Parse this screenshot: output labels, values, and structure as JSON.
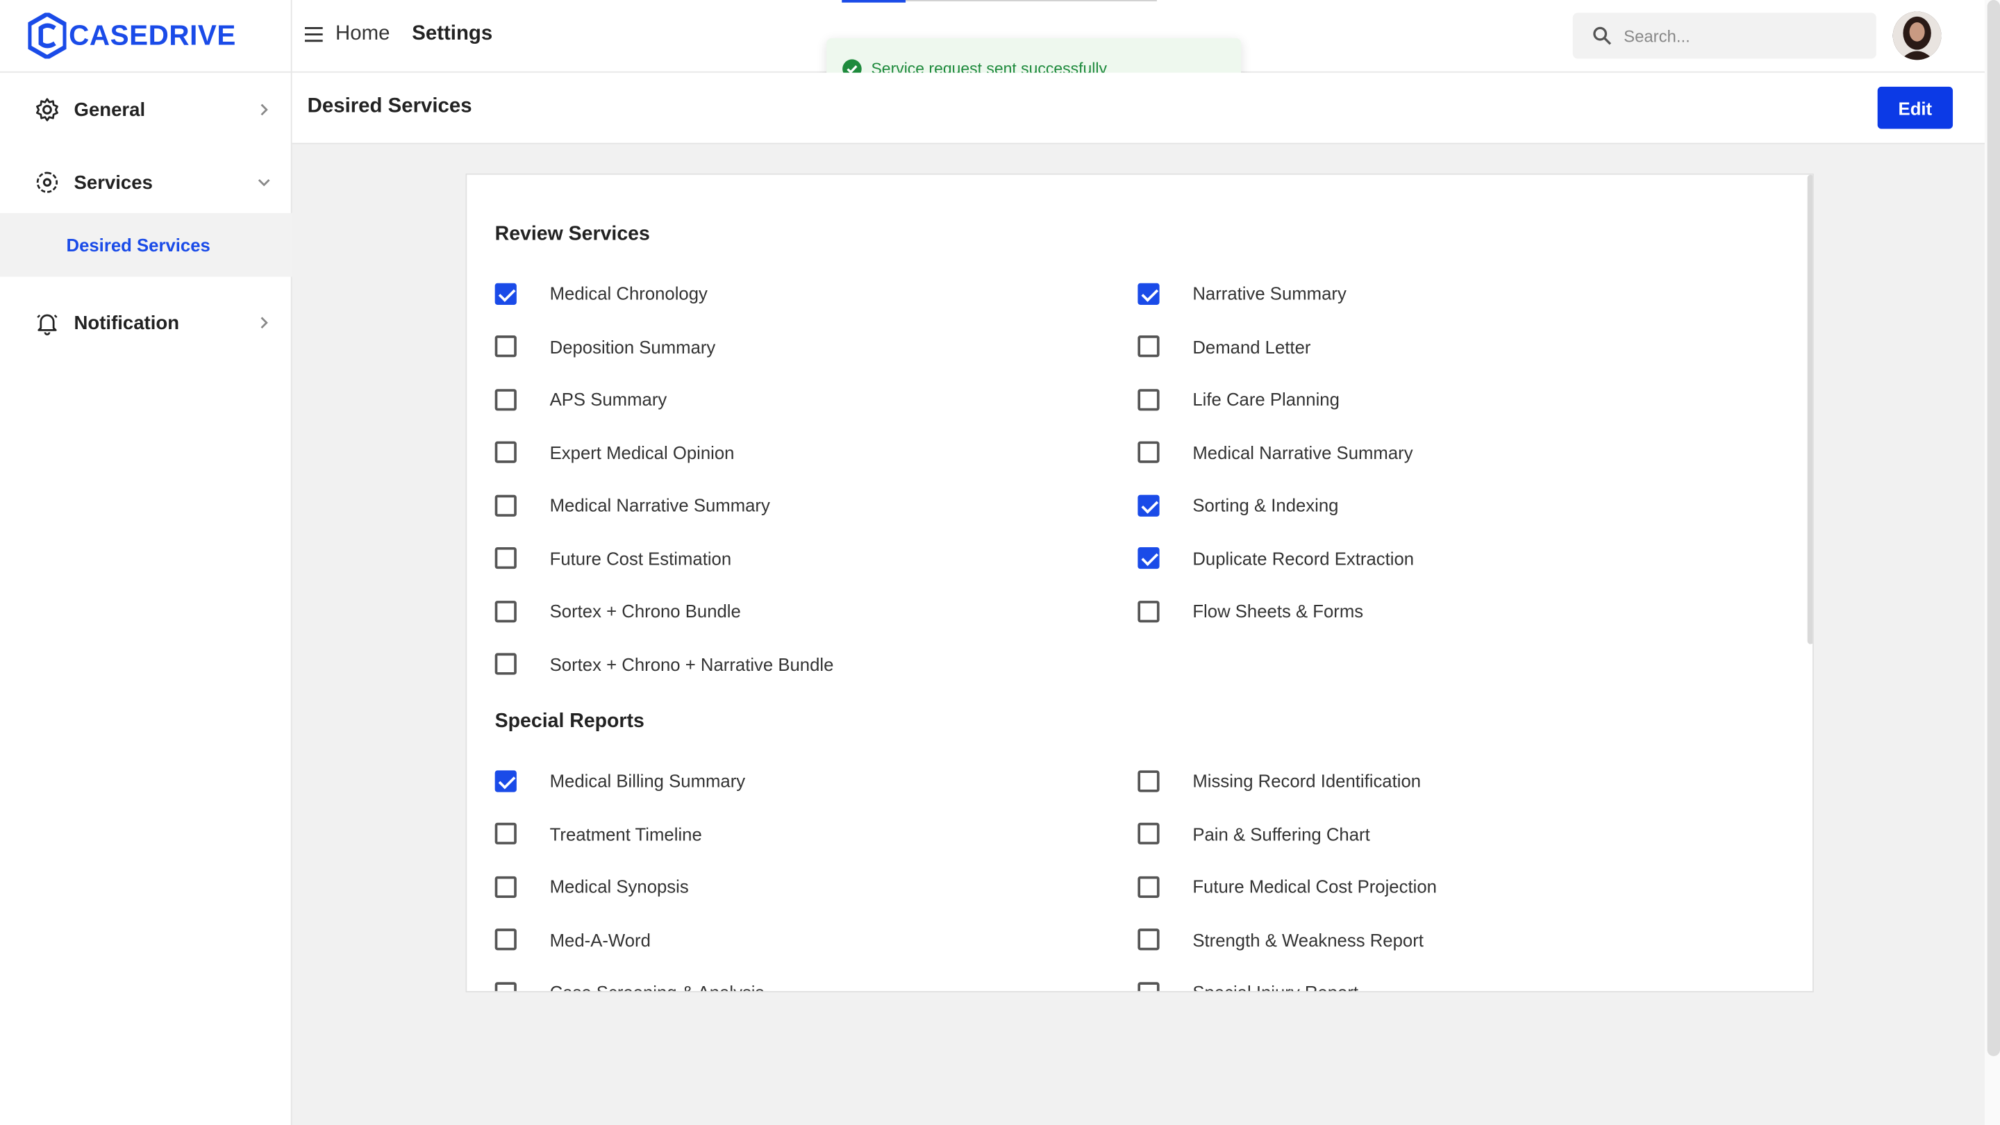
{
  "app": {
    "brand": "CASEDRIVE",
    "brand_color": "#1a4be8"
  },
  "topbar": {
    "home_label": "Home",
    "settings_label": "Settings",
    "search_placeholder": "Search..."
  },
  "toast": {
    "message": "Service request sent successfully",
    "status_color": "#1e8a3c"
  },
  "sidebar": {
    "items": [
      {
        "label": "General",
        "icon": "gear-icon",
        "expanded": false
      },
      {
        "label": "Services",
        "icon": "settings-cog-icon",
        "expanded": true
      },
      {
        "label": "Notification",
        "icon": "bell-icon",
        "expanded": false
      }
    ],
    "sub_items": [
      {
        "label": "Desired Services",
        "active": true
      }
    ]
  },
  "page": {
    "title": "Desired Services",
    "edit_label": "Edit"
  },
  "review_services": {
    "title": "Review Services",
    "left": [
      {
        "label": "Medical Chronology",
        "checked": true
      },
      {
        "label": "Deposition Summary",
        "checked": false
      },
      {
        "label": "APS Summary",
        "checked": false
      },
      {
        "label": "Expert Medical Opinion",
        "checked": false
      },
      {
        "label": "Medical Narrative Summary",
        "checked": false
      },
      {
        "label": "Future Cost Estimation",
        "checked": false
      },
      {
        "label": "Sortex + Chrono Bundle",
        "checked": false
      },
      {
        "label": "Sortex + Chrono + Narrative Bundle",
        "checked": false
      }
    ],
    "right": [
      {
        "label": "Narrative Summary",
        "checked": true
      },
      {
        "label": "Demand Letter",
        "checked": false
      },
      {
        "label": "Life Care Planning",
        "checked": false
      },
      {
        "label": "Medical Narrative Summary",
        "checked": false
      },
      {
        "label": "Sorting & Indexing",
        "checked": true
      },
      {
        "label": "Duplicate Record Extraction",
        "checked": true
      },
      {
        "label": "Flow Sheets & Forms",
        "checked": false
      }
    ]
  },
  "special_reports": {
    "title": "Special Reports",
    "left": [
      {
        "label": "Medical Billing Summary",
        "checked": true
      },
      {
        "label": "Treatment Timeline",
        "checked": false
      },
      {
        "label": "Medical Synopsis",
        "checked": false
      },
      {
        "label": "Med-A-Word",
        "checked": false
      },
      {
        "label": "Case Screening & Analysis",
        "checked": false
      }
    ],
    "right": [
      {
        "label": "Missing Record Identification",
        "checked": false
      },
      {
        "label": "Pain & Suffering Chart",
        "checked": false
      },
      {
        "label": "Future Medical Cost Projection",
        "checked": false
      },
      {
        "label": "Strength & Weakness Report",
        "checked": false
      },
      {
        "label": "Special Injury Report",
        "checked": false
      }
    ]
  }
}
